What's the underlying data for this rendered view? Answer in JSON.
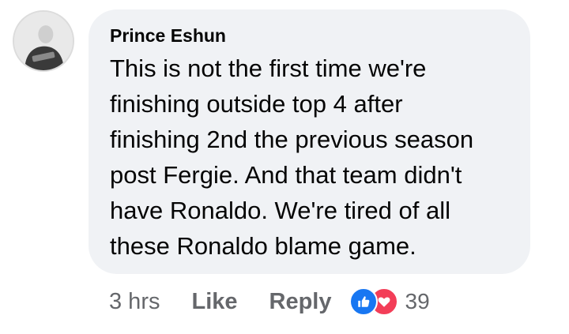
{
  "comment": {
    "author": "Prince Eshun",
    "text": "This is not the first time we're\nfinishing outside top 4 after\nfinishing 2nd the previous season\npost Fergie. And that team didn't\nhave Ronaldo. We're tired of all\nthese Ronaldo blame game.",
    "timestamp": "3 hrs",
    "actions": {
      "like_label": "Like",
      "reply_label": "Reply"
    },
    "reactions": {
      "icons": [
        "like-icon",
        "love-icon"
      ],
      "count": "39"
    }
  },
  "colors": {
    "bubble_background": "#f0f2f5",
    "meta_text": "#65676b",
    "like_blue": "#1877f2",
    "love_red": "#f33e58"
  }
}
